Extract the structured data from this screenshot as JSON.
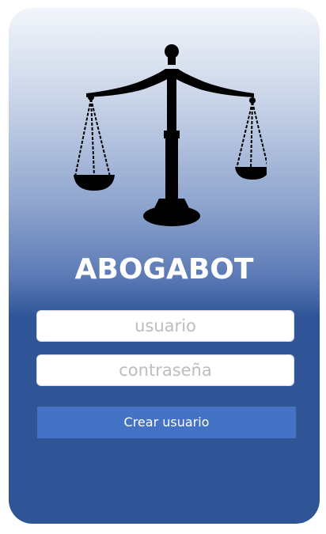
{
  "app": {
    "title": "ABOGABOT",
    "logo_icon": "scales-of-justice-icon"
  },
  "form": {
    "username_placeholder": "usuario",
    "username_value": "",
    "password_placeholder": "contraseña",
    "password_value": "",
    "create_user_label": "Crear usuario"
  },
  "colors": {
    "accent": "#4472c4",
    "background_dark": "#2f5597",
    "background_light": "#f2f5fb",
    "text_on_dark": "#ffffff",
    "placeholder": "#bdbdbd"
  }
}
